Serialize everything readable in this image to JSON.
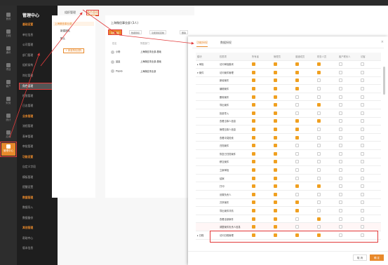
{
  "iconbar": {
    "items": [
      {
        "label": "首页"
      },
      {
        "label": "日程"
      },
      {
        "label": "通讯"
      },
      {
        "label": "项目"
      },
      {
        "label": "客户"
      },
      {
        "label": "财务"
      },
      {
        "label": "统计"
      },
      {
        "label": "应用"
      },
      {
        "label": "管理中心",
        "active": true
      }
    ]
  },
  "mgmt": {
    "title": "管理中心",
    "rows": [
      {
        "label": "基础设置",
        "type": "group"
      },
      {
        "label": "单位信息",
        "type": "item"
      },
      {
        "label": "公司管理",
        "type": "item"
      },
      {
        "label": "部门管理",
        "type": "item"
      },
      {
        "label": "组织架构",
        "type": "item"
      },
      {
        "label": "岗位管理",
        "type": "item"
      },
      {
        "label": "角色管理",
        "type": "highlight"
      },
      {
        "label": "权限管理",
        "type": "item"
      },
      {
        "label": "日志管理",
        "type": "item"
      },
      {
        "label": "业务管理",
        "type": "group"
      },
      {
        "label": "流程管理",
        "type": "item"
      },
      {
        "label": "表单管理",
        "type": "item"
      },
      {
        "label": "审批管理",
        "type": "item"
      },
      {
        "label": "功能设置",
        "type": "group"
      },
      {
        "label": "自定义字段",
        "type": "item"
      },
      {
        "label": "模板管理",
        "type": "item"
      },
      {
        "label": "提醒设置",
        "type": "item"
      },
      {
        "label": "数据管理",
        "type": "group"
      },
      {
        "label": "数据导入",
        "type": "item"
      },
      {
        "label": "数据备份",
        "type": "item"
      },
      {
        "label": "其他管理",
        "type": "group"
      },
      {
        "label": "帮助中心",
        "type": "item"
      },
      {
        "label": "版本信息",
        "type": "item"
      }
    ]
  },
  "mid_tabs": [
    {
      "label": "组织管理",
      "active": false
    },
    {
      "label": "角色管理",
      "active": true
    }
  ],
  "roles": {
    "items": [
      {
        "label": "上海微信事业部",
        "selected": true
      },
      {
        "label": "新建团队",
        "selected": false
      },
      {
        "label": "默认",
        "selected": false
      }
    ],
    "add_label": "+ 新建角色团队"
  },
  "role_detail": {
    "title": "上海微信事业部 (3人)",
    "buttons": [
      {
        "label": "功能授权",
        "primary": true
      },
      {
        "label": "数据授权",
        "primary": false
      },
      {
        "label": "功能授权复制",
        "primary": false
      },
      {
        "label": "删除",
        "primary": false
      }
    ],
    "headers": [
      "姓名",
      "所属部门"
    ],
    "members": [
      {
        "name": "小杨",
        "dept": "上海微信事业部-基础"
      },
      {
        "name": "晨晨",
        "dept": "上海微信事业部-基础"
      },
      {
        "name": "Pipolo",
        "dept": "上海微信事业部"
      }
    ]
  },
  "dialog": {
    "tabs": [
      {
        "label": "功能授权",
        "active": true
      },
      {
        "label": "数据授权",
        "active": false
      }
    ],
    "close": "×",
    "headers": [
      "模块",
      "权限项",
      "所有者",
      "管理员",
      "普通成员",
      "财务人员",
      "客户联系人",
      "访客"
    ],
    "rows": [
      {
        "module": "▸ 审批",
        "perm": "访问审批模块",
        "checks": [
          true,
          true,
          true,
          true,
          false,
          false
        ]
      },
      {
        "module": "▾ 案件",
        "perm": "访问案件管理",
        "checks": [
          true,
          true,
          true,
          true,
          false,
          false
        ]
      },
      {
        "module": "",
        "perm": "新增案件",
        "checks": [
          true,
          true,
          true,
          false,
          false,
          false
        ]
      },
      {
        "module": "",
        "perm": "编辑案件",
        "checks": [
          true,
          true,
          true,
          false,
          false,
          false
        ]
      },
      {
        "module": "",
        "perm": "删除案件",
        "checks": [
          true,
          true,
          false,
          false,
          false,
          false
        ]
      },
      {
        "module": "",
        "perm": "导出案件",
        "checks": [
          true,
          true,
          false,
          true,
          false,
          false
        ]
      },
      {
        "module": "",
        "perm": "批量导入",
        "checks": [
          true,
          true,
          false,
          false,
          false,
          false
        ]
      },
      {
        "module": "",
        "perm": "查看当事人信息",
        "checks": [
          true,
          true,
          true,
          true,
          false,
          false
        ]
      },
      {
        "module": "",
        "perm": "管理当事人信息",
        "checks": [
          true,
          true,
          true,
          false,
          false,
          false
        ]
      },
      {
        "module": "",
        "perm": "查看冲突检索",
        "checks": [
          true,
          true,
          true,
          false,
          false,
          false
        ]
      },
      {
        "module": "",
        "perm": "归档案件",
        "checks": [
          true,
          true,
          false,
          false,
          false,
          false
        ]
      },
      {
        "module": "",
        "perm": "恢复已归档案件",
        "checks": [
          true,
          true,
          false,
          false,
          false,
          false
        ]
      },
      {
        "module": "",
        "perm": "移交案件",
        "checks": [
          true,
          true,
          false,
          false,
          false,
          false
        ]
      },
      {
        "module": "",
        "perm": "立案审批",
        "checks": [
          true,
          true,
          false,
          false,
          false,
          false
        ]
      },
      {
        "module": "",
        "perm": "结案",
        "checks": [
          true,
          true,
          false,
          false,
          false,
          false
        ]
      },
      {
        "module": "",
        "perm": "打印",
        "checks": [
          true,
          true,
          true,
          true,
          false,
          false
        ]
      },
      {
        "module": "",
        "perm": "设置负责人",
        "checks": [
          true,
          true,
          false,
          false,
          false,
          false
        ]
      },
      {
        "module": "",
        "perm": "共享案件",
        "checks": [
          true,
          true,
          true,
          false,
          false,
          false
        ]
      },
      {
        "module": "",
        "perm": "导出案件详情",
        "checks": [
          true,
          true,
          true,
          false,
          false,
          false
        ]
      },
      {
        "module": "",
        "perm": "查看全部案件",
        "checks": [
          true,
          true,
          false,
          true,
          false,
          false
        ]
      },
      {
        "module": "",
        "perm": "调整案件负责人信息",
        "checks": [
          true,
          true,
          false,
          false,
          false,
          false
        ],
        "highlight": true
      },
      {
        "module": "▸ 日程",
        "perm": "访问日程管理",
        "checks": [
          true,
          true,
          true,
          true,
          false,
          false
        ]
      }
    ],
    "cancel_label": "取 消",
    "ok_label": "确 定"
  }
}
